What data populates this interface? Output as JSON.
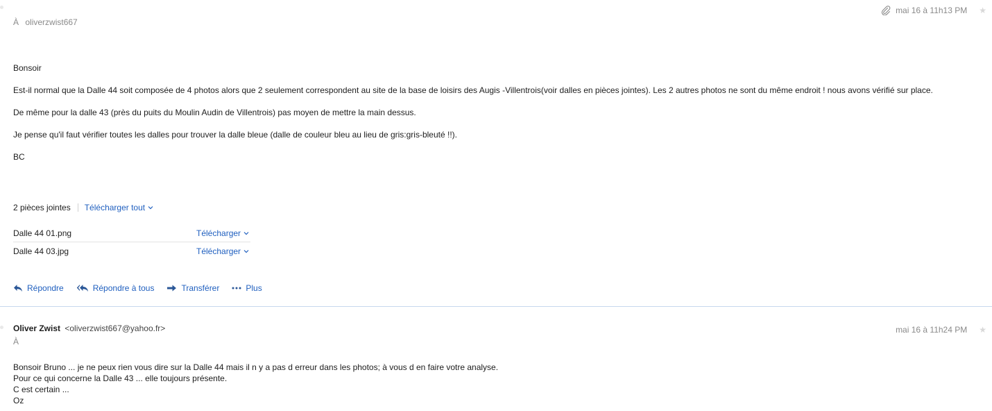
{
  "message1": {
    "to_label": "À",
    "recipient": "oliverzwist667",
    "date": "mai 16 à 11h13 PM",
    "icons": {
      "attachment": "paperclip-icon",
      "flag": "star-icon"
    },
    "body": [
      "Bonsoir",
      "Est-il normal que la Dalle 44 soit composée de 4 photos alors que 2 seulement correspondent au site de la base de loisirs des Augis -Villentrois(voir dalles en pièces jointes). Les 2 autres photos ne sont du même endroit ! nous avons vérifié sur place.",
      "De même pour la dalle 43 (près du puits du Moulin Audin de Villentrois) pas moyen de mettre la main dessus.",
      "Je pense qu'il faut vérifier toutes les dalles pour trouver la dalle bleue (dalle de couleur bleu au lieu de gris:gris-bleuté !!).",
      "BC"
    ],
    "attachments_summary": "2 pièces jointes",
    "download_all": "Télécharger tout",
    "attachments": [
      {
        "name": "Dalle 44 01.png",
        "action": "Télécharger"
      },
      {
        "name": "Dalle 44 03.jpg",
        "action": "Télécharger"
      }
    ],
    "actions": {
      "reply": "Répondre",
      "reply_all": "Répondre à tous",
      "forward": "Transférer",
      "more": "Plus"
    }
  },
  "message2": {
    "sender_name": "Oliver Zwist",
    "sender_email": "<oliverzwist667@yahoo.fr>",
    "to_label": "À",
    "date": "mai 16 à 11h24 PM",
    "body": [
      "Bonsoir Bruno ... je ne peux rien vous dire sur la Dalle 44 mais il n y a pas d erreur dans les photos; à vous d en faire votre analyse.",
      "Pour ce qui concerne la Dalle 43 ... elle toujours présente.",
      "C est certain ...",
      "Oz"
    ]
  },
  "colors": {
    "link": "#1f5fbf",
    "muted": "#8a8a8a",
    "text": "#1d1d1d",
    "divider": "#c7d8ee"
  }
}
